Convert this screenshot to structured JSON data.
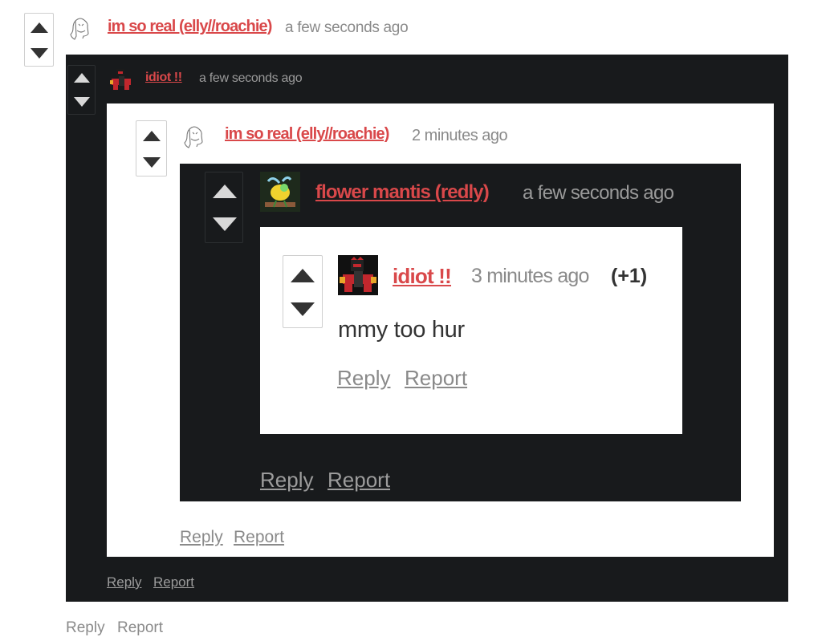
{
  "colors": {
    "author": "#d9484a",
    "dark_bg": "#181a1c",
    "light_bg": "#ffffff",
    "muted": "#8a8a8a"
  },
  "icons": {
    "upvote": "triangle-up",
    "downvote": "triangle-down",
    "avatar_sketch": "sketch-creature-avatar",
    "avatar_robot": "red-black-robot-avatar",
    "avatar_mantis": "mantis-avatar"
  },
  "comments": {
    "c1": {
      "author": "im so real (elly//roachie)",
      "time": "a few seconds ago",
      "reply": "Reply",
      "report": "Report"
    },
    "c2": {
      "author": "idiot !!",
      "time": "a few seconds ago",
      "reply": "Reply",
      "report": "Report"
    },
    "c3": {
      "author": "im so real (elly//roachie)",
      "time": "2 minutes ago",
      "reply": "Reply",
      "report": "Report"
    },
    "c4": {
      "author": "flower mantis (redly)",
      "time": "a few seconds ago",
      "reply": "Reply",
      "report": "Report"
    },
    "c5": {
      "author": "idiot !!",
      "time": "3 minutes ago",
      "score": "(+1)",
      "body": "mmy too hur",
      "reply": "Reply",
      "report": "Report"
    }
  }
}
